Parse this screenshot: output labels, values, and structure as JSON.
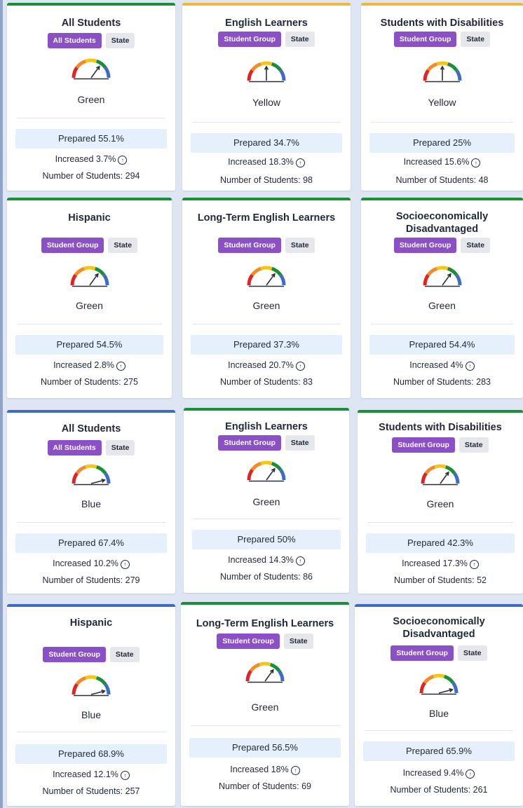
{
  "colors": {
    "green": "#1a8f3a",
    "yellow": "#f0b73a",
    "blue": "#3f6bc4",
    "badge_purple": "#8b4fc6",
    "prepared_bg": "#e6f0fc"
  },
  "gauge_segments": [
    "#e02424",
    "#f28c28",
    "#f5c518",
    "#1a8f3a",
    "#3f6bc4"
  ],
  "cards": [
    {
      "title": "All Students",
      "badge": "All Students",
      "state": "State",
      "level": "Green",
      "color": "green",
      "needle": 0.7,
      "prepared": "Prepared 55.1%",
      "increased": "Increased 3.7%",
      "students": "Number of Students: 294"
    },
    {
      "title": "English Learners",
      "badge": "Student Group",
      "state": "State",
      "level": "Yellow",
      "color": "yellow",
      "needle": 0.5,
      "prepared": "Prepared 34.7%",
      "increased": "Increased 18.3%",
      "students": "Number of Students: 98"
    },
    {
      "title": "Students with Disabilities",
      "badge": "Student Group",
      "state": "State",
      "level": "Yellow",
      "color": "yellow",
      "needle": 0.5,
      "prepared": "Prepared 25%",
      "increased": "Increased 15.6%",
      "students": "Number of Students: 48"
    },
    {
      "title": "Hispanic",
      "badge": "Student Group",
      "state": "State",
      "level": "Green",
      "color": "green",
      "needle": 0.7,
      "prepared": "Prepared 54.5%",
      "increased": "Increased 2.8%",
      "students": "Number of Students: 275"
    },
    {
      "title": "Long-Term English Learners",
      "badge": "Student Group",
      "state": "State",
      "level": "Green",
      "color": "green",
      "needle": 0.7,
      "prepared": "Prepared 37.3%",
      "increased": "Increased 20.7%",
      "students": "Number of Students: 83"
    },
    {
      "title": "Socioeconomically Disadvantaged",
      "badge": "Student Group",
      "state": "State",
      "level": "Green",
      "color": "green",
      "needle": 0.7,
      "prepared": "Prepared 54.4%",
      "increased": "Increased 4%",
      "students": "Number of Students: 283"
    },
    {
      "title": "All Students",
      "badge": "All Students",
      "state": "State",
      "level": "Blue",
      "color": "blue",
      "needle": 0.92,
      "prepared": "Prepared 67.4%",
      "increased": "Increased 10.2%",
      "students": "Number of Students: 279"
    },
    {
      "title": "English Learners",
      "badge": "Student Group",
      "state": "State",
      "level": "Green",
      "color": "green",
      "needle": 0.7,
      "prepared": "Prepared 50%",
      "increased": "Increased 14.3%",
      "students": "Number of Students: 86"
    },
    {
      "title": "Students with Disabilities",
      "badge": "Student Group",
      "state": "State",
      "level": "Green",
      "color": "green",
      "needle": 0.7,
      "prepared": "Prepared 42.3%",
      "increased": "Increased 17.3%",
      "students": "Number of Students: 52"
    },
    {
      "title": "Hispanic",
      "badge": "Student Group",
      "state": "State",
      "level": "Blue",
      "color": "blue",
      "needle": 0.92,
      "prepared": "Prepared 68.9%",
      "increased": "Increased 12.1%",
      "students": "Number of Students: 257"
    },
    {
      "title": "Long-Term English Learners",
      "badge": "Student Group",
      "state": "State",
      "level": "Green",
      "color": "green",
      "needle": 0.7,
      "prepared": "Prepared 56.5%",
      "increased": "Increased 18%",
      "students": "Number of Students: 69"
    },
    {
      "title": "Socioeconomically Disadvantaged",
      "badge": "Student Group",
      "state": "State",
      "level": "Blue",
      "color": "blue",
      "needle": 0.92,
      "prepared": "Prepared 65.9%",
      "increased": "Increased 9.4%",
      "students": "Number of Students: 261"
    }
  ]
}
